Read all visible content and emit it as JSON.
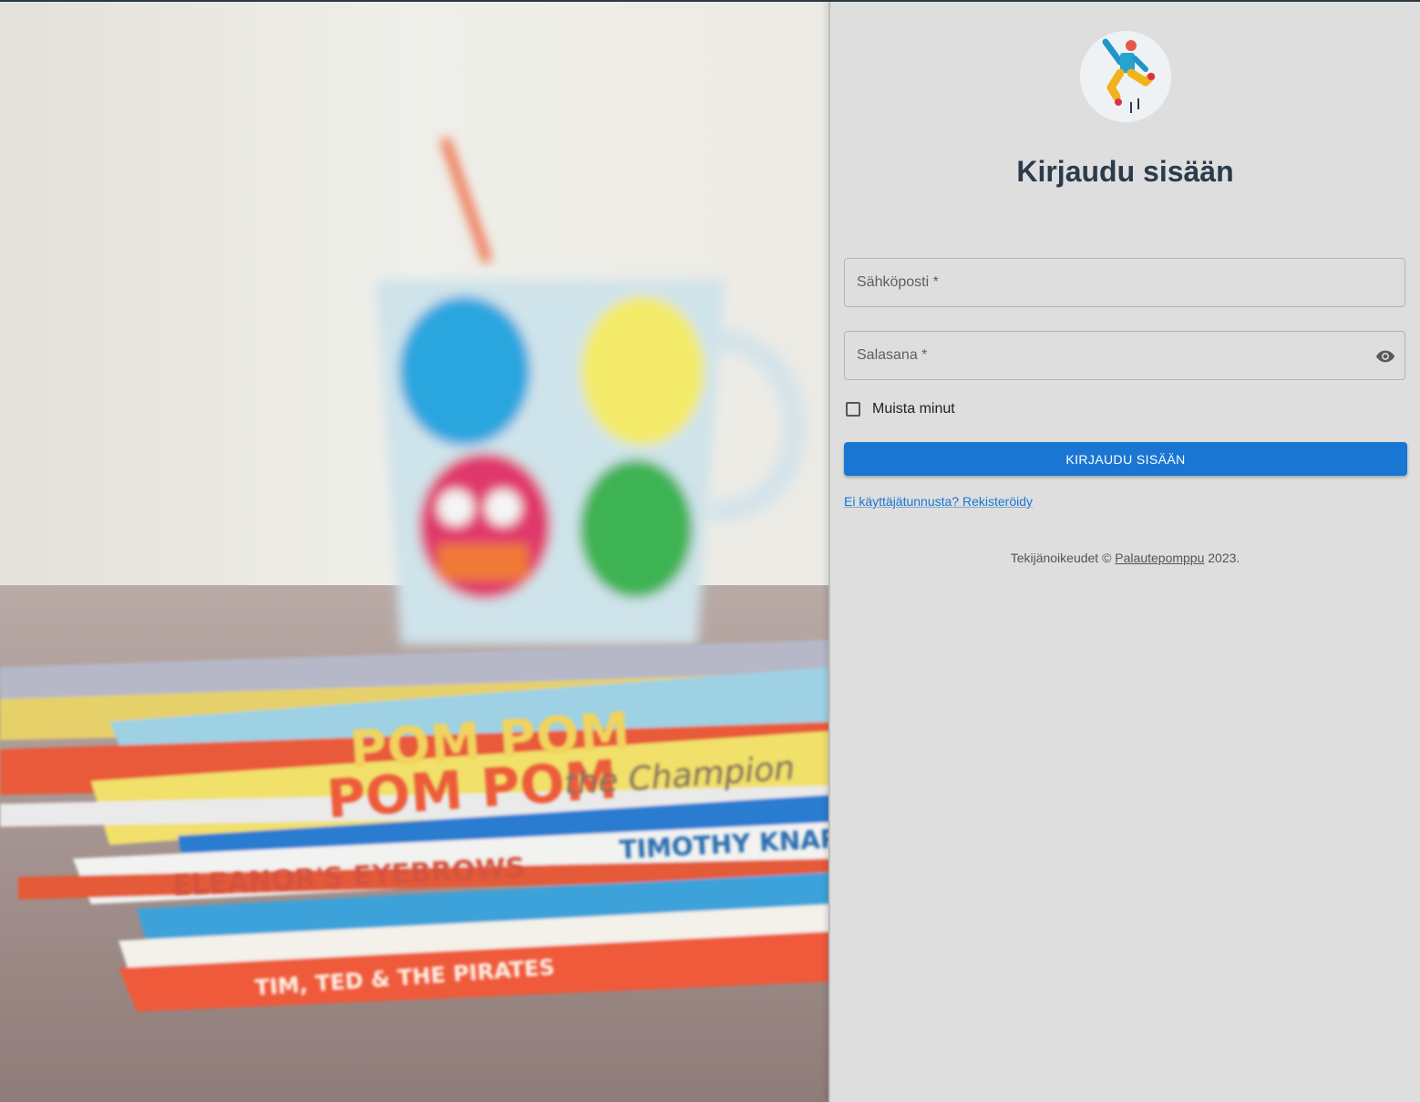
{
  "hero": {
    "image_name": "mug-and-books-photo"
  },
  "logo": {
    "icon": "jumping-person-logo-icon"
  },
  "login": {
    "title": "Kirjaudu sisään",
    "email_label": "Sähköposti *",
    "email_value": "",
    "password_label": "Salasana *",
    "password_value": "",
    "password_toggle_icon": "eye-icon",
    "remember_label": "Muista minut",
    "remember_checked": false,
    "submit_label": "KIRJAUDU SISÄÄN",
    "register_link": "Ei käyttäjätunnusta? Rekisteröidy"
  },
  "footer": {
    "prefix": "Tekijänoikeudet © ",
    "brand": "Palautepomppu",
    "suffix": " 2023."
  },
  "colors": {
    "primary": "#1976d2",
    "title": "#2a3b4c",
    "panel_bg": "#dedede"
  }
}
